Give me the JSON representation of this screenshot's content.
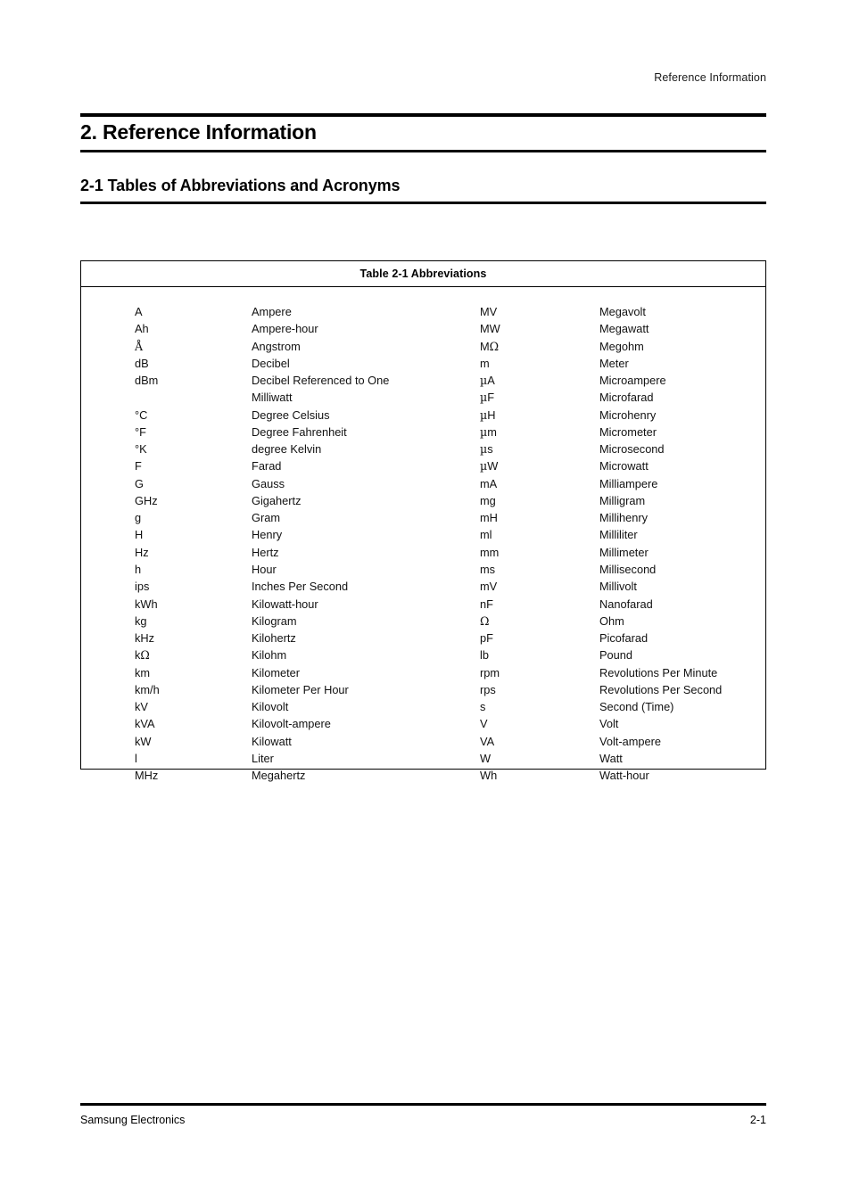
{
  "header": {
    "running_title": "Reference Information"
  },
  "chapter": {
    "title": "2. Reference Information"
  },
  "section": {
    "title": "2-1 Tables of Abbreviations and Acronyms"
  },
  "table": {
    "caption": "Table 2-1 Abbreviations",
    "left_column": [
      {
        "abbr": "A",
        "definition": "Ampere"
      },
      {
        "abbr": "Ah",
        "definition": "Ampere-hour"
      },
      {
        "abbr": "Å",
        "definition": "Angstrom"
      },
      {
        "abbr": "dB",
        "definition": "Decibel"
      },
      {
        "abbr": "dBm",
        "definition": "Decibel Referenced to One"
      },
      {
        "abbr": "",
        "definition": "Milliwatt"
      },
      {
        "abbr": "°C",
        "definition": "Degree Celsius"
      },
      {
        "abbr": "°F",
        "definition": "Degree Fahrenheit"
      },
      {
        "abbr": "°K",
        "definition": "degree Kelvin"
      },
      {
        "abbr": "F",
        "definition": "Farad"
      },
      {
        "abbr": "G",
        "definition": "Gauss"
      },
      {
        "abbr": "GHz",
        "definition": "Gigahertz"
      },
      {
        "abbr": "g",
        "definition": "Gram"
      },
      {
        "abbr": "H",
        "definition": "Henry"
      },
      {
        "abbr": "Hz",
        "definition": "Hertz"
      },
      {
        "abbr": "h",
        "definition": "Hour"
      },
      {
        "abbr": "ips",
        "definition": "Inches Per Second"
      },
      {
        "abbr": "kWh",
        "definition": "Kilowatt-hour"
      },
      {
        "abbr": "kg",
        "definition": "Kilogram"
      },
      {
        "abbr": "kHz",
        "definition": "Kilohertz"
      },
      {
        "abbr": "kΩ",
        "definition": "Kilohm"
      },
      {
        "abbr": "km",
        "definition": "Kilometer"
      },
      {
        "abbr": "km/h",
        "definition": "Kilometer Per Hour"
      },
      {
        "abbr": "kV",
        "definition": "Kilovolt"
      },
      {
        "abbr": "kVA",
        "definition": "Kilovolt-ampere"
      },
      {
        "abbr": "kW",
        "definition": "Kilowatt"
      },
      {
        "abbr": "l",
        "definition": "Liter"
      },
      {
        "abbr": "MHz",
        "definition": "Megahertz"
      }
    ],
    "right_column": [
      {
        "abbr": "MV",
        "definition": "Megavolt"
      },
      {
        "abbr": "MW",
        "definition": "Megawatt"
      },
      {
        "abbr": "MΩ",
        "definition": "Megohm"
      },
      {
        "abbr": "m",
        "definition": "Meter"
      },
      {
        "abbr": "µA",
        "definition": "Microampere"
      },
      {
        "abbr": "µF",
        "definition": "Microfarad"
      },
      {
        "abbr": "µH",
        "definition": "Microhenry"
      },
      {
        "abbr": "µm",
        "definition": "Micrometer"
      },
      {
        "abbr": "µs",
        "definition": "Microsecond"
      },
      {
        "abbr": "µW",
        "definition": "Microwatt"
      },
      {
        "abbr": "mA",
        "definition": "Milliampere"
      },
      {
        "abbr": "mg",
        "definition": "Milligram"
      },
      {
        "abbr": "mH",
        "definition": "Millihenry"
      },
      {
        "abbr": "ml",
        "definition": "Milliliter"
      },
      {
        "abbr": "mm",
        "definition": "Millimeter"
      },
      {
        "abbr": "ms",
        "definition": "Millisecond"
      },
      {
        "abbr": "mV",
        "definition": "Millivolt"
      },
      {
        "abbr": "nF",
        "definition": "Nanofarad"
      },
      {
        "abbr": "Ω",
        "definition": "Ohm"
      },
      {
        "abbr": "pF",
        "definition": "Picofarad"
      },
      {
        "abbr": "lb",
        "definition": "Pound"
      },
      {
        "abbr": "rpm",
        "definition": "Revolutions Per Minute"
      },
      {
        "abbr": "rps",
        "definition": "Revolutions Per Second"
      },
      {
        "abbr": "s",
        "definition": "Second (Time)"
      },
      {
        "abbr": "V",
        "definition": "Volt"
      },
      {
        "abbr": "VA",
        "definition": "Volt-ampere"
      },
      {
        "abbr": "W",
        "definition": "Watt"
      },
      {
        "abbr": "Wh",
        "definition": "Watt-hour"
      }
    ]
  },
  "footer": {
    "company": "Samsung Electronics",
    "page_number": "2-1"
  }
}
